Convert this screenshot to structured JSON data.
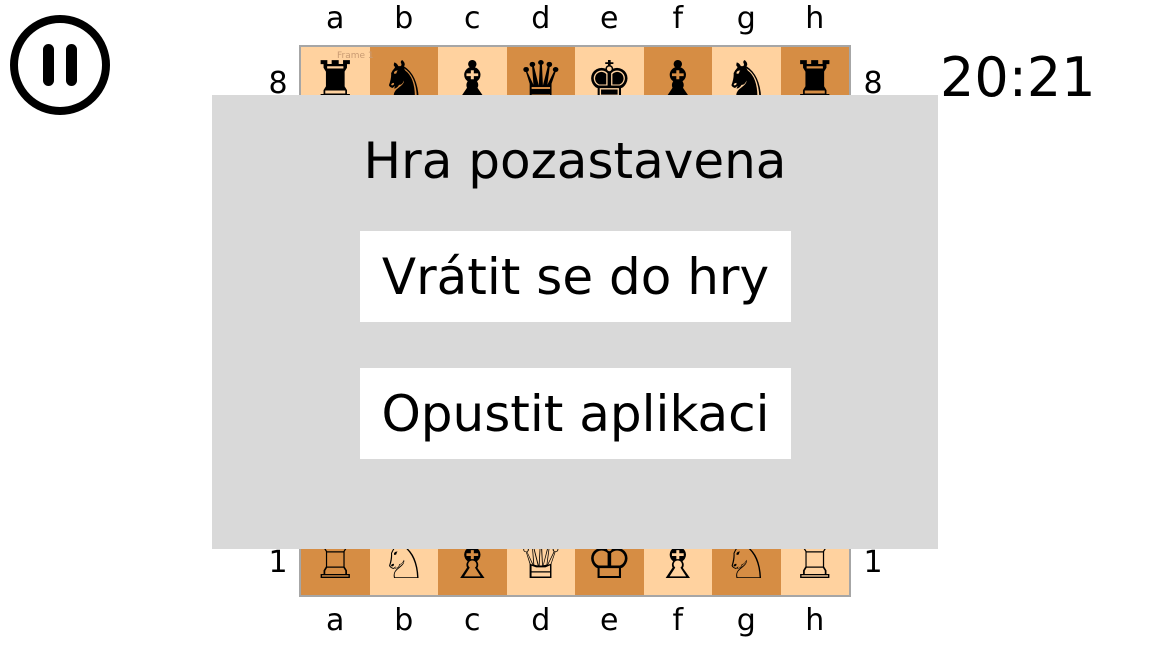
{
  "timer": "20:21",
  "pause": {
    "icon": "pause-icon"
  },
  "board": {
    "files": [
      "a",
      "b",
      "c",
      "d",
      "e",
      "f",
      "g",
      "h"
    ],
    "ranks_visible": [
      "8",
      "1"
    ],
    "frame_tag": "Frame 1",
    "colors": {
      "light": "#ffd29f",
      "dark": "#d68d44",
      "border": "#a6a6a6"
    },
    "rank8": [
      "♜",
      "♞",
      "♝",
      "♛",
      "♚",
      "♝",
      "♞",
      "♜"
    ],
    "rank1": [
      "♖",
      "♘",
      "♗",
      "♕",
      "♔",
      "♗",
      "♘",
      "♖"
    ]
  },
  "pause_menu": {
    "title": "Hra pozastavena",
    "resume_label": "Vrátit se do hry",
    "quit_label": "Opustit aplikaci",
    "overlay_color": "#d9d9d9"
  }
}
